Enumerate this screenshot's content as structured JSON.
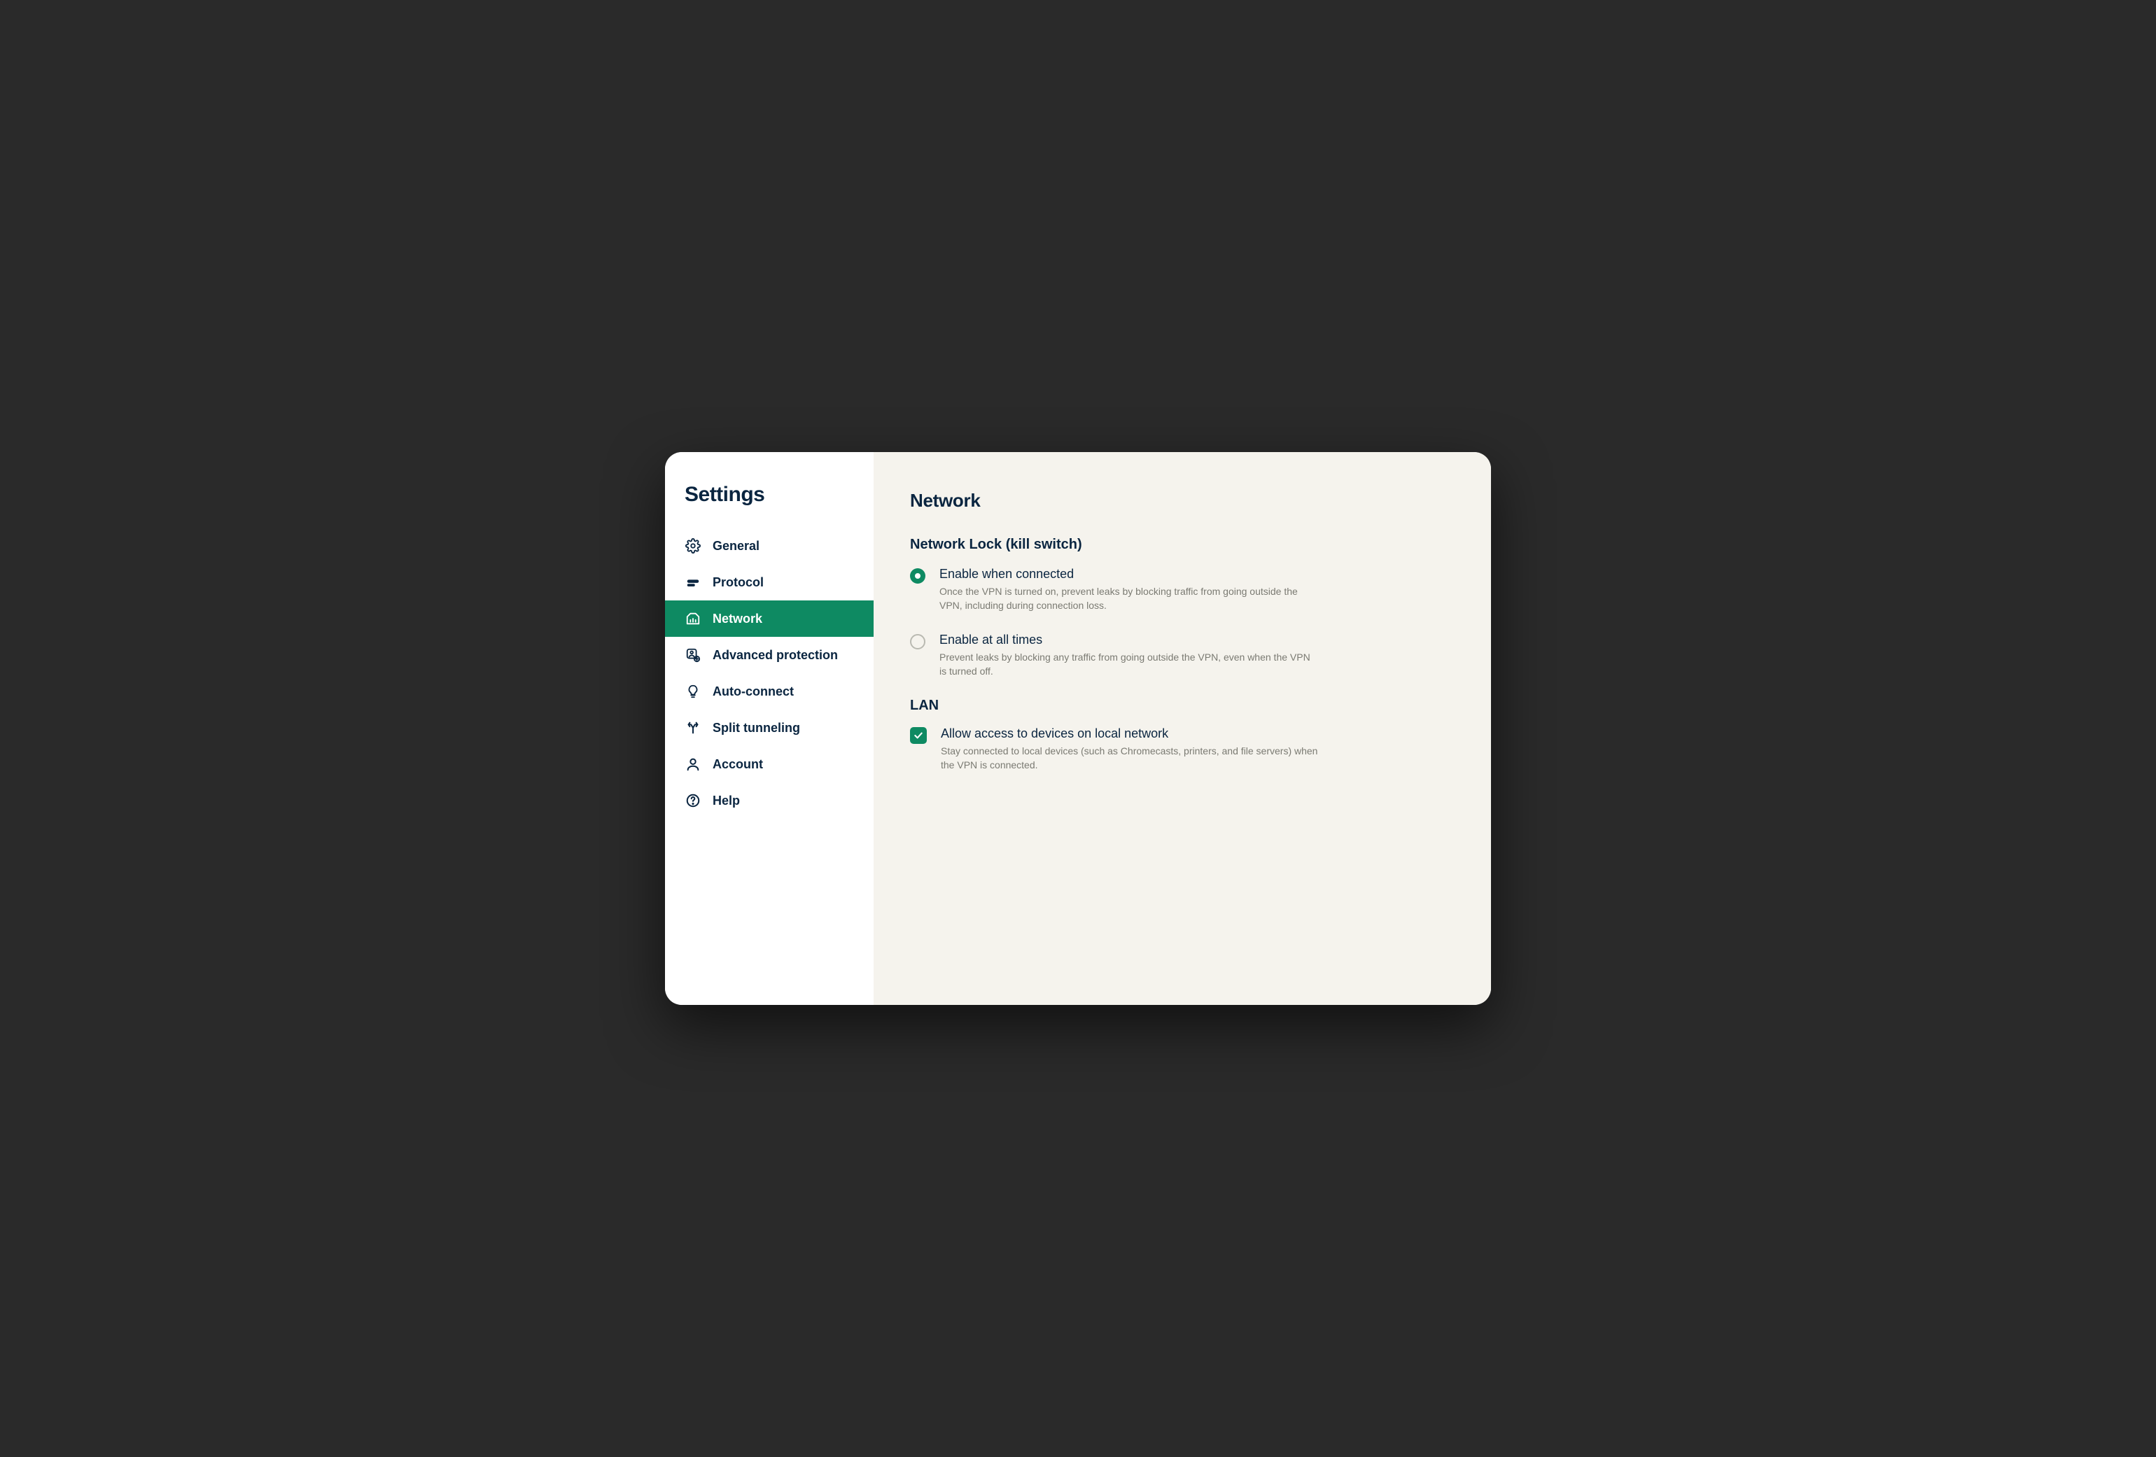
{
  "colors": {
    "accent": "#0e8a62",
    "text": "#0a2540",
    "muted": "#7a7a72",
    "contentBg": "#f5f3ed"
  },
  "sidebar": {
    "title": "Settings",
    "items": [
      {
        "label": "General"
      },
      {
        "label": "Protocol"
      },
      {
        "label": "Network"
      },
      {
        "label": "Advanced protection"
      },
      {
        "label": "Auto-connect"
      },
      {
        "label": "Split tunneling"
      },
      {
        "label": "Account"
      },
      {
        "label": "Help"
      }
    ],
    "activeIndex": 2
  },
  "content": {
    "title": "Network",
    "networkLock": {
      "heading": "Network Lock (kill switch)",
      "options": [
        {
          "label": "Enable when connected",
          "description": "Once the VPN is turned on, prevent leaks by blocking traffic from going outside the VPN, including during connection loss.",
          "selected": true
        },
        {
          "label": "Enable at all times",
          "description": "Prevent leaks by blocking any traffic from going outside the VPN, even when the VPN is turned off.",
          "selected": false
        }
      ]
    },
    "lan": {
      "heading": "LAN",
      "option": {
        "label": "Allow access to devices on local network",
        "description": "Stay connected to local devices (such as Chromecasts, printers, and file servers) when the VPN is connected.",
        "checked": true
      }
    }
  }
}
